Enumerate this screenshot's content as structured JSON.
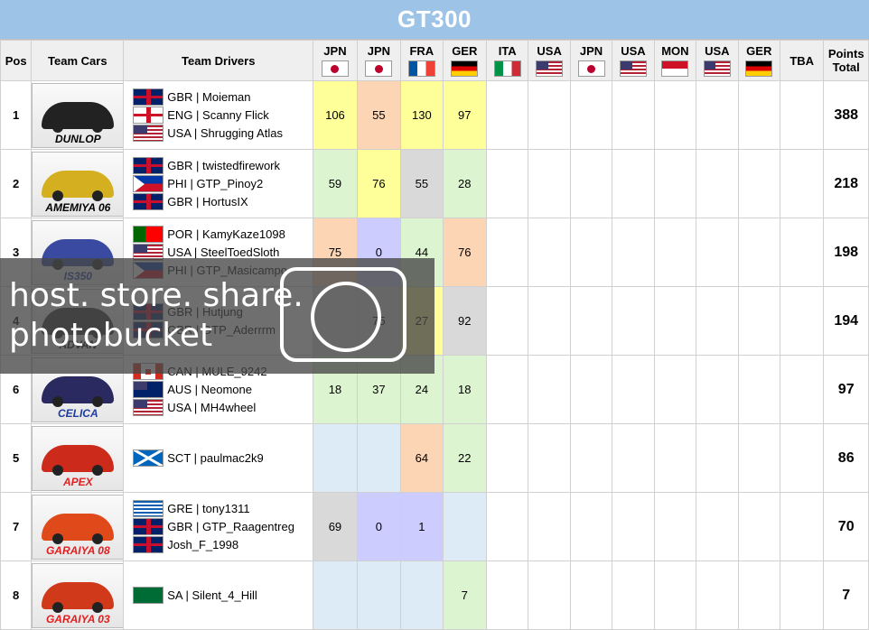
{
  "title": "GT300",
  "headers": {
    "pos": "Pos",
    "cars": "Team Cars",
    "drivers": "Team Drivers",
    "tba": "TBA",
    "points_line1": "Points",
    "points_line2": "Total"
  },
  "races": [
    {
      "label": "JPN",
      "flag": "jpn"
    },
    {
      "label": "JPN",
      "flag": "jpn"
    },
    {
      "label": "FRA",
      "flag": "fra"
    },
    {
      "label": "GER",
      "flag": "ger"
    },
    {
      "label": "ITA",
      "flag": "ita"
    },
    {
      "label": "USA",
      "flag": "usa"
    },
    {
      "label": "JPN",
      "flag": "jpn"
    },
    {
      "label": "USA",
      "flag": "usa"
    },
    {
      "label": "MON",
      "flag": "mon"
    },
    {
      "label": "USA",
      "flag": "usa"
    },
    {
      "label": "GER",
      "flag": "ger"
    }
  ],
  "rows": [
    {
      "pos": "1",
      "car": "DUNLOP",
      "car_color": "#222222",
      "name_color": "#000000",
      "drivers": [
        {
          "text": "GBR | Moieman",
          "flag": "gbr"
        },
        {
          "text": "ENG | Scanny Flick",
          "flag": "eng"
        },
        {
          "text": "USA | Shrugging Atlas",
          "flag": "usa"
        }
      ],
      "points": [
        {
          "v": "106",
          "c": "yel"
        },
        {
          "v": "55",
          "c": "ora"
        },
        {
          "v": "130",
          "c": "yel"
        },
        {
          "v": "97",
          "c": "yel"
        }
      ],
      "total": "388"
    },
    {
      "pos": "2",
      "car": "AMEMIYA 06",
      "car_color": "#d4b020",
      "name_color": "#000000",
      "drivers": [
        {
          "text": "GBR | twistedfirework",
          "flag": "gbr"
        },
        {
          "text": "PHI | GTP_Pinoy2",
          "flag": "phi"
        },
        {
          "text": "GBR | HortusIX",
          "flag": "gbr"
        }
      ],
      "points": [
        {
          "v": "59",
          "c": "gre"
        },
        {
          "v": "76",
          "c": "yel"
        },
        {
          "v": "55",
          "c": "gry"
        },
        {
          "v": "28",
          "c": "gre"
        }
      ],
      "total": "218"
    },
    {
      "pos": "3",
      "car": "IS350",
      "car_color": "#3a4aa0",
      "name_color": "#1f3c9e",
      "drivers": [
        {
          "text": "POR | KamyKaze1098",
          "flag": "por"
        },
        {
          "text": "USA | SteelToedSloth",
          "flag": "usa"
        },
        {
          "text": "PHI | GTP_Masicampo",
          "flag": "phi"
        }
      ],
      "points": [
        {
          "v": "75",
          "c": "ora"
        },
        {
          "v": "0",
          "c": "pur"
        },
        {
          "v": "44",
          "c": "gre"
        },
        {
          "v": "76",
          "c": "ora"
        }
      ],
      "total": "198"
    },
    {
      "pos": "4",
      "car": "ADVAN",
      "car_color": "#333333",
      "name_color": "#000000",
      "drivers": [
        {
          "text": "GBR | Hutjung",
          "flag": "gbr"
        },
        {
          "text": "GBR | GTP_Aderrrm",
          "flag": "gbr"
        }
      ],
      "points": [
        {
          "v": "",
          "c": "gry"
        },
        {
          "v": "75",
          "c": "gry"
        },
        {
          "v": "27",
          "c": "yel"
        },
        {
          "v": "92",
          "c": "gry"
        }
      ],
      "total": "194"
    },
    {
      "pos": "6",
      "car": "CELICA",
      "car_color": "#2a2a60",
      "name_color": "#1f3c9e",
      "drivers": [
        {
          "text": "CAN | MULE_9242",
          "flag": "can"
        },
        {
          "text": "AUS | Neomone",
          "flag": "aus"
        },
        {
          "text": "USA | MH4wheel",
          "flag": "usa"
        }
      ],
      "points": [
        {
          "v": "18",
          "c": "gre"
        },
        {
          "v": "37",
          "c": "gre"
        },
        {
          "v": "24",
          "c": "gre"
        },
        {
          "v": "18",
          "c": "gre"
        }
      ],
      "total": "97"
    },
    {
      "pos": "5",
      "car": "APEX",
      "car_color": "#cc2a1a",
      "name_color": "#e02020",
      "drivers": [
        {
          "text": "SCT | paulmac2k9",
          "flag": "sct"
        }
      ],
      "points": [
        {
          "v": "",
          "c": "blu"
        },
        {
          "v": "",
          "c": "blu"
        },
        {
          "v": "64",
          "c": "ora"
        },
        {
          "v": "22",
          "c": "gre"
        }
      ],
      "total": "86"
    },
    {
      "pos": "7",
      "car": "GARAIYA 08",
      "car_color": "#e04a1a",
      "name_color": "#e02020",
      "drivers": [
        {
          "text": "GRE | tony1311",
          "flag": "gre"
        },
        {
          "text": "GBR | GTP_Raagentreg",
          "flag": "gbr"
        },
        {
          "text": "Josh_F_1998",
          "flag": "gbr"
        }
      ],
      "points": [
        {
          "v": "69",
          "c": "gry"
        },
        {
          "v": "0",
          "c": "pur"
        },
        {
          "v": "1",
          "c": "pur"
        },
        {
          "v": "",
          "c": "blu"
        }
      ],
      "total": "70"
    },
    {
      "pos": "8",
      "car": "GARAIYA 03",
      "car_color": "#d03a1a",
      "name_color": "#e02020",
      "drivers": [
        {
          "text": "SA | Silent_4_Hill",
          "flag": "sa"
        }
      ],
      "points": [
        {
          "v": "",
          "c": "blu"
        },
        {
          "v": "",
          "c": "blu"
        },
        {
          "v": "",
          "c": "blu"
        },
        {
          "v": "7",
          "c": "gre"
        }
      ],
      "total": "7"
    }
  ],
  "watermark": {
    "line1": "host. store. share.",
    "line2": "photobucket"
  }
}
